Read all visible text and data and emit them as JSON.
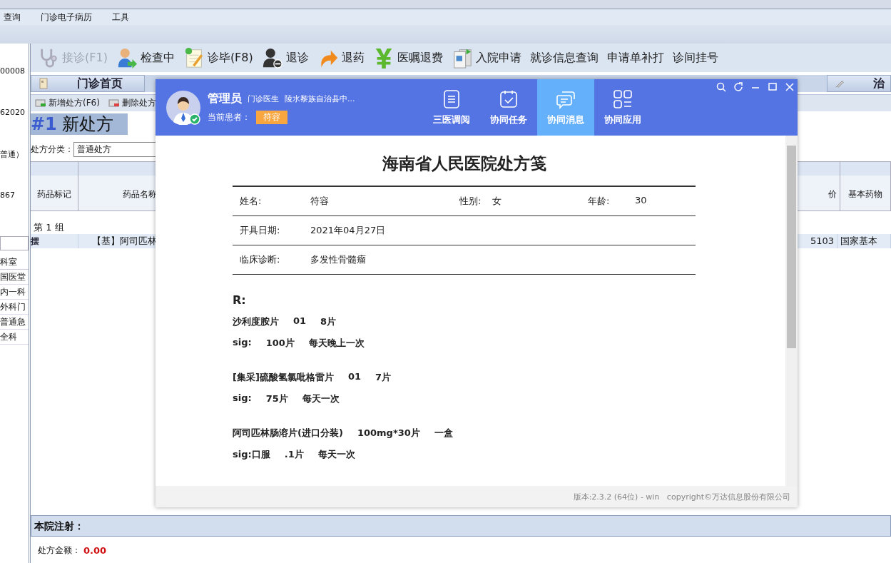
{
  "menu": [
    "查询",
    "门诊电子病历",
    "工具"
  ],
  "toolbar": [
    {
      "label": "接诊(F1)",
      "disabled": true
    },
    {
      "label": "检查中",
      "disabled": false
    },
    {
      "label": "诊毕(F8)",
      "disabled": false
    },
    {
      "label": "退诊",
      "disabled": false
    },
    {
      "label": "退药",
      "disabled": false
    },
    {
      "label": "医嘱退费",
      "disabled": false
    },
    {
      "label": "入院申请",
      "disabled": false
    },
    {
      "label": "就诊信息查询",
      "disabled": false
    },
    {
      "label": "申请单补打",
      "disabled": false
    },
    {
      "label": "诊间挂号",
      "disabled": false
    }
  ],
  "left_panel": {
    "texts": [
      "00008",
      "62020",
      "普通）",
      "867"
    ],
    "list_header": "科室",
    "items": [
      "国医堂",
      "内一科",
      "外科门",
      "普通急",
      "全科"
    ]
  },
  "tabs": [
    {
      "label": "门诊首页",
      "selected": false
    },
    {
      "label": "治",
      "selected": false
    }
  ],
  "sub_toolbar": [
    "新增处方(F6)",
    "删除处方"
  ],
  "prescription_title": {
    "number": "#1",
    "name": "新处方"
  },
  "category": {
    "label": "处方分类：",
    "value": "普通处方"
  },
  "table": {
    "columns": [
      "药品标记",
      "药品名称",
      "价",
      "基本药物"
    ],
    "group": "第 1 组",
    "row": {
      "mark": "摆",
      "name": "【基】阿司匹林",
      "code": "5103",
      "basic": "国家基本"
    }
  },
  "injection_label": "本院注射：",
  "amount": {
    "label": "处方金额：",
    "value": "0.00"
  },
  "popup": {
    "user": "管理员",
    "role": "门诊医生",
    "org": "陵水黎族自治县中...",
    "patient_label": "当前患者：",
    "patient": "符容",
    "nav": [
      {
        "label": "三医调阅",
        "selected": false
      },
      {
        "label": "协同任务",
        "selected": false
      },
      {
        "label": "协同消息",
        "selected": true
      },
      {
        "label": "协同应用",
        "selected": false
      }
    ],
    "document": {
      "title": "海南省人民医院处方笺",
      "rows": [
        [
          {
            "label": "姓名:",
            "value": "符容"
          },
          {
            "label": "性别:",
            "value": "女"
          },
          {
            "label": "年龄:",
            "value": "30"
          }
        ],
        [
          {
            "label": "开具日期:",
            "value": "2021年04月27日"
          }
        ],
        [
          {
            "label": "临床诊断:",
            "value": "多发性骨髓瘤"
          }
        ]
      ],
      "r_label": "R:",
      "items": [
        {
          "drug": [
            "沙利度胺片",
            "01",
            "8片"
          ],
          "sig": [
            "sig:",
            "100片",
            "每天晚上一次"
          ]
        },
        {
          "drug": [
            "[集采]硫酸氢氯吡格雷片",
            "01",
            "7片"
          ],
          "sig": [
            "sig:",
            "75片",
            "每天一次"
          ]
        },
        {
          "drug": [
            "阿司匹林肠溶片(进口分装)",
            "100mg*30片",
            "一盒"
          ],
          "sig": [
            "sig:口服",
            ".1片",
            "每天一次"
          ]
        }
      ]
    },
    "footer": "版本:2.3.2 (64位) - win   copyright©万达信息股份有限公司"
  }
}
